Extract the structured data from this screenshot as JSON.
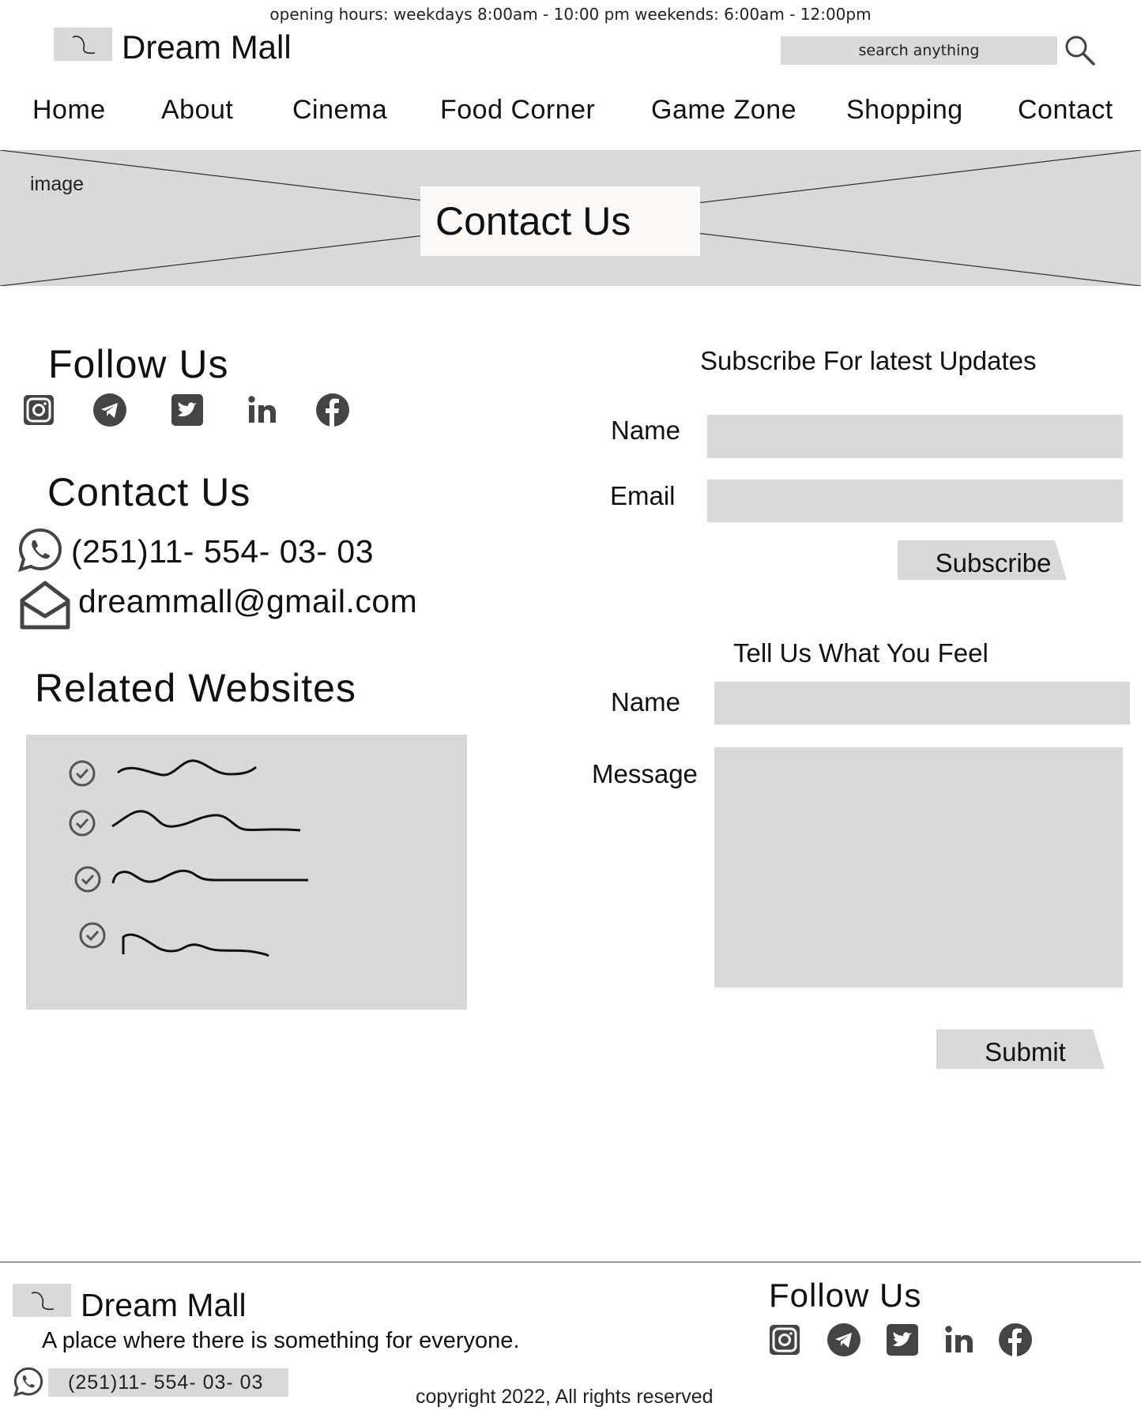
{
  "top_bar": {
    "hours": "opening hours: weekdays 8:00am - 10:00 pm  weekends: 6:00am - 12:00pm"
  },
  "header": {
    "brand": "Dream Mall",
    "search_placeholder": "search anything"
  },
  "nav": {
    "items": [
      "Home",
      "About",
      "Cinema",
      "Food Corner",
      "Game Zone",
      "Shopping",
      "Contact"
    ]
  },
  "hero": {
    "image_label": "image",
    "title": "Contact Us"
  },
  "follow": {
    "title": "Follow Us",
    "icons": [
      "instagram-icon",
      "telegram-icon",
      "twitter-icon",
      "linkedin-icon",
      "facebook-icon"
    ]
  },
  "contact": {
    "title": "Contact Us",
    "phone": "(251)11- 554- 03- 03",
    "email": "dreammall@gmail.com"
  },
  "related": {
    "title": "Related Websites",
    "items_count": 4
  },
  "subscribe": {
    "title": "Subscribe For latest Updates",
    "name_label": "Name",
    "email_label": "Email",
    "button": "Subscribe"
  },
  "feedback": {
    "title": "Tell Us What You Feel",
    "name_label": "Name",
    "message_label": "Message",
    "button": "Submit"
  },
  "footer": {
    "brand": "Dream Mall",
    "tagline": "A place where there is something for everyone.",
    "phone": "(251)11- 554- 03- 03",
    "follow_title": "Follow Us",
    "copyright": "copyright 2022, All rights reserved"
  },
  "colors": {
    "placeholder_gray": "#d9d9d9",
    "icon_gray": "#444444",
    "text": "#111111"
  }
}
